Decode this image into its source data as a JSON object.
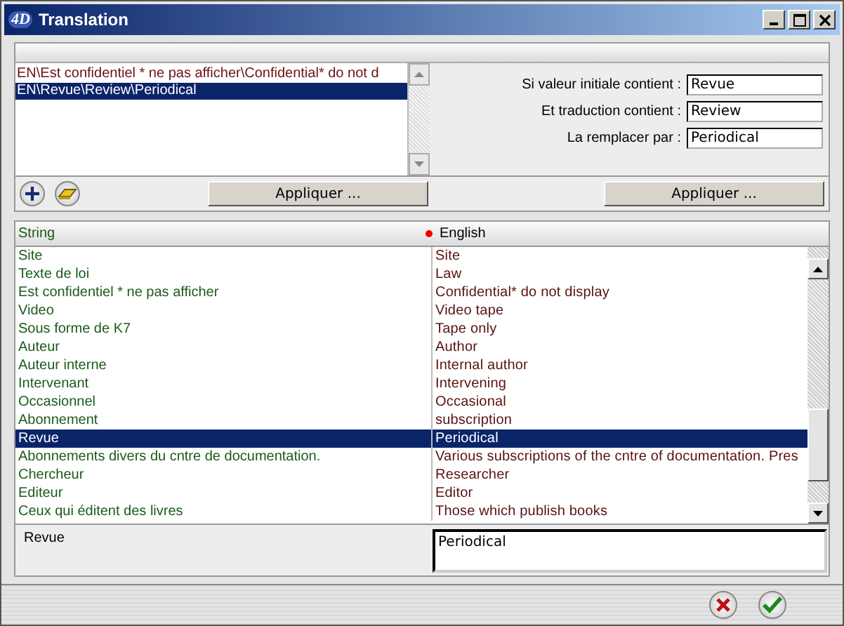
{
  "window": {
    "logo": "4D",
    "title": "Translation"
  },
  "rules": {
    "items": [
      {
        "text": "EN\\Est confidentiel * ne pas afficher\\Confidential* do not d",
        "selected": false
      },
      {
        "text": "EN\\Revue\\Review\\Periodical",
        "selected": true
      }
    ]
  },
  "filters": [
    {
      "label": "Si valeur initiale contient :",
      "value": "Revue"
    },
    {
      "label": "Et traduction contient :",
      "value": "Review"
    },
    {
      "label": "La remplacer par :",
      "value": "Periodical"
    }
  ],
  "apply_buttons": [
    "Appliquer ...",
    "Appliquer ..."
  ],
  "grid": {
    "columns": [
      {
        "label": "String"
      },
      {
        "label": "English"
      }
    ],
    "rows": [
      {
        "string": "Site",
        "english": "Site",
        "selected": false
      },
      {
        "string": "Texte de loi",
        "english": "Law",
        "selected": false
      },
      {
        "string": "Est confidentiel * ne pas afficher",
        "english": "Confidential* do not display",
        "selected": false
      },
      {
        "string": "Video",
        "english": "Video tape",
        "selected": false
      },
      {
        "string": "Sous forme de K7",
        "english": "Tape only",
        "selected": false
      },
      {
        "string": "Auteur",
        "english": "Author",
        "selected": false
      },
      {
        "string": "Auteur interne",
        "english": "Internal author",
        "selected": false
      },
      {
        "string": "Intervenant",
        "english": "Intervening",
        "selected": false
      },
      {
        "string": "Occasionnel",
        "english": "Occasional",
        "selected": false
      },
      {
        "string": "Abonnement",
        "english": "subscription",
        "selected": false
      },
      {
        "string": "Revue",
        "english": "Periodical",
        "selected": true
      },
      {
        "string": "Abonnements divers du cntre de documentation.",
        "english": "Various subscriptions of the cntre of documentation. Pres",
        "selected": false
      },
      {
        "string": "Chercheur",
        "english": "Researcher",
        "selected": false
      },
      {
        "string": "Editeur",
        "english": "Editor",
        "selected": false
      },
      {
        "string": "Ceux qui éditent des livres",
        "english": "Those which publish books",
        "selected": false
      }
    ]
  },
  "editor": {
    "source": "Revue",
    "translation": "Periodical"
  }
}
